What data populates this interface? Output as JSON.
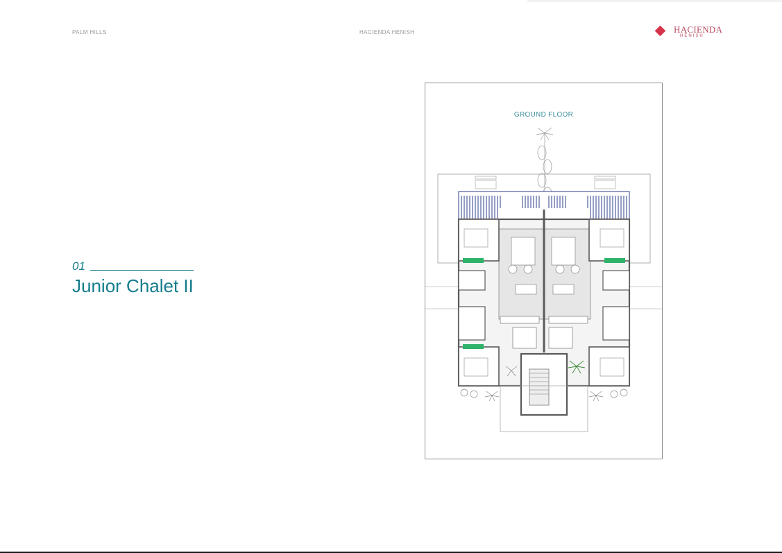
{
  "header": {
    "left_text": "PALM HILLS",
    "center_text": "HACIENDA HENISH",
    "logo": {
      "brand": "HACIENDA",
      "subtitle": "HENISH",
      "icon": "diamond-logo-icon",
      "color": "#d6334a"
    }
  },
  "section": {
    "number": "01",
    "title": "Junior Chalet II",
    "accent_color": "#157d8c"
  },
  "floorplan": {
    "label": "GROUND FLOOR"
  }
}
